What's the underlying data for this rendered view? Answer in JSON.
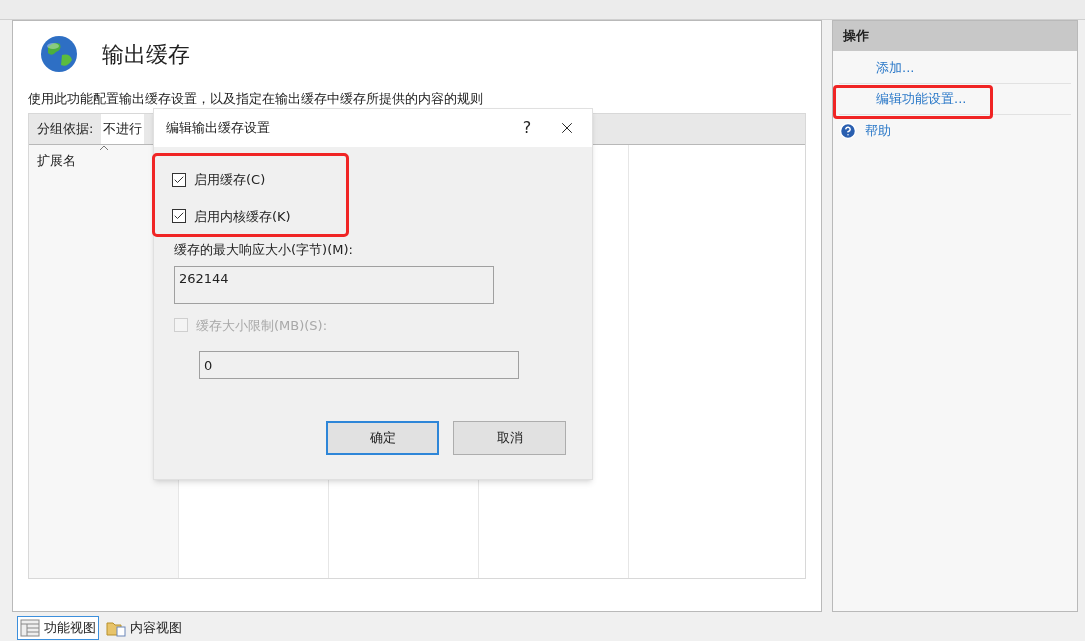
{
  "feature": {
    "title": "输出缓存",
    "description": "使用此功能配置输出缓存设置，以及指定在输出缓存中缓存所提供的内容的规则"
  },
  "grid": {
    "group_label": "分组依据:",
    "group_value": "不进行",
    "columns": [
      "扩展名"
    ]
  },
  "dialog": {
    "title": "编辑输出缓存设置",
    "help": "?",
    "checkboxes": {
      "highlighted": true,
      "items": [
        {
          "label": "启用缓存(C)",
          "checked": true
        },
        {
          "label": "启用内核缓存(K)",
          "checked": true
        }
      ]
    },
    "max_size": {
      "label": "缓存的最大响应大小(字节)(M):",
      "value": "262144"
    },
    "limit": {
      "label": "缓存大小限制(MB)(S):",
      "checked": false,
      "disabled": true,
      "value": "0"
    },
    "buttons": [
      {
        "label": "确定",
        "default": true
      },
      {
        "label": "取消",
        "default": false
      }
    ]
  },
  "actions": {
    "title": "操作",
    "items": [
      {
        "label": "添加...",
        "kind": "link",
        "highlighted": false
      },
      {
        "label": "编辑功能设置...",
        "kind": "link",
        "highlighted": true
      },
      {
        "label": "帮助",
        "kind": "help",
        "highlighted": false
      }
    ]
  },
  "views": [
    {
      "label": "功能视图",
      "selected": true
    },
    {
      "label": "内容视图",
      "selected": false
    }
  ]
}
